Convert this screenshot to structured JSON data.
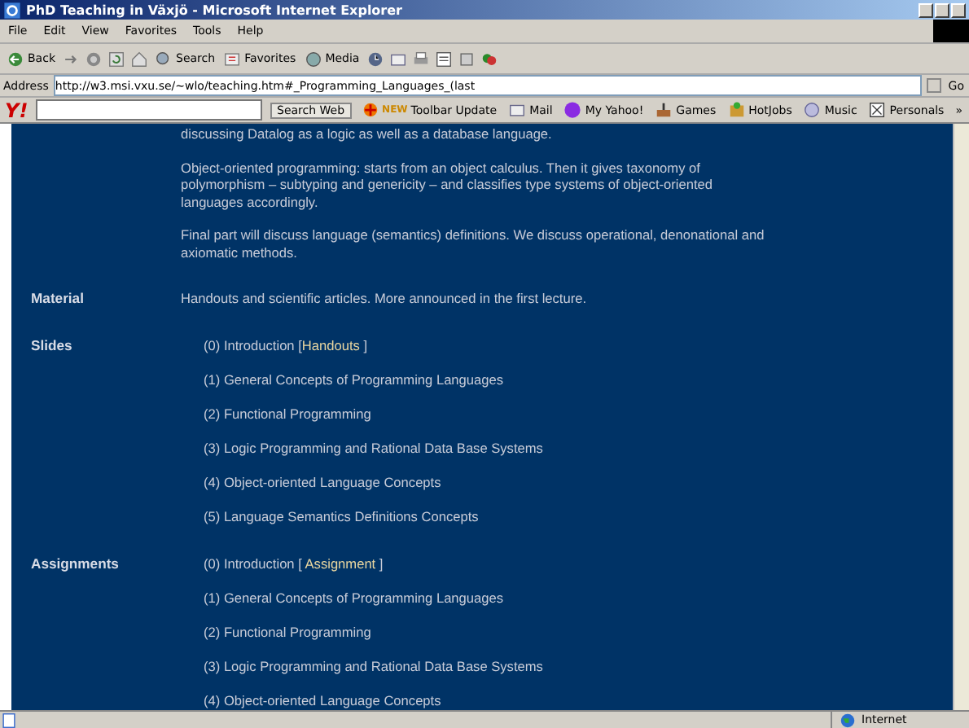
{
  "window": {
    "title": "PhD Teaching in Växjö - Microsoft Internet Explorer"
  },
  "menu": [
    "File",
    "Edit",
    "View",
    "Favorites",
    "Tools",
    "Help"
  ],
  "toolbar": [
    {
      "kind": "back",
      "label": "Back"
    },
    {
      "kind": "forward"
    },
    {
      "kind": "stop"
    },
    {
      "kind": "refresh"
    },
    {
      "kind": "home"
    },
    {
      "kind": "search",
      "label": "Search"
    },
    {
      "kind": "favorites",
      "label": "Favorites"
    },
    {
      "kind": "media",
      "label": "Media"
    },
    {
      "kind": "history"
    },
    {
      "kind": "mail"
    },
    {
      "kind": "print"
    },
    {
      "kind": "edit"
    },
    {
      "kind": "discuss"
    },
    {
      "kind": "messenger"
    }
  ],
  "address": {
    "label": "Address",
    "value": "http://w3.msi.vxu.se/~wlo/teaching.htm#_Programming_Languages_(last",
    "go": "Go"
  },
  "yahoo": {
    "logo": "Y!",
    "search_button": "Search Web",
    "items": [
      {
        "kind": "update",
        "label": "Toolbar Update",
        "badge": "NEW"
      },
      {
        "kind": "mail",
        "label": "Mail"
      },
      {
        "kind": "myyahoo",
        "label": "My Yahoo!"
      },
      {
        "kind": "games",
        "label": "Games"
      },
      {
        "kind": "hotjobs",
        "label": "HotJobs"
      },
      {
        "kind": "music",
        "label": "Music"
      },
      {
        "kind": "personals",
        "label": "Personals"
      }
    ],
    "more": "»"
  },
  "content": {
    "top_line": "discussing Datalog as a logic as well as a database language.",
    "paragraphs": [
      "Object-oriented programming: starts from an object calculus. Then it gives taxonomy of polymorphism – subtyping and genericity – and classifies type systems of object-oriented languages accordingly.",
      "Final part will discuss language (semantics) definitions. We discuss operational, denonational and axiomatic methods."
    ],
    "sections": [
      {
        "label": "Material",
        "items": [
          {
            "text": "Handouts and scientific articles. More announced in the first lecture."
          }
        ]
      },
      {
        "label": "Slides",
        "items": [
          {
            "text": "(0) Introduction [",
            "link": "Handouts",
            "after": " ]"
          },
          {
            "text": "(1) General Concepts of Programming Languages"
          },
          {
            "text": "(2) Functional Programming"
          },
          {
            "text": "(3)  Logic Programming and Rational Data Base Systems"
          },
          {
            "text": "(4)  Object-oriented Language Concepts"
          },
          {
            "text": "(5)  Language Semantics Definitions Concepts"
          }
        ]
      },
      {
        "label": "Assignments",
        "items": [
          {
            "text": "(0) Introduction [ ",
            "link": "Assignment",
            "after": " ]"
          },
          {
            "text": "(1) General Concepts of Programming Languages"
          },
          {
            "text": "(2) Functional Programming"
          },
          {
            "text": "(3)  Logic Programming and Rational Data Base Systems"
          },
          {
            "text": "(4)  Object-oriented Language Concepts"
          }
        ]
      }
    ]
  },
  "status": {
    "zone": "Internet"
  }
}
